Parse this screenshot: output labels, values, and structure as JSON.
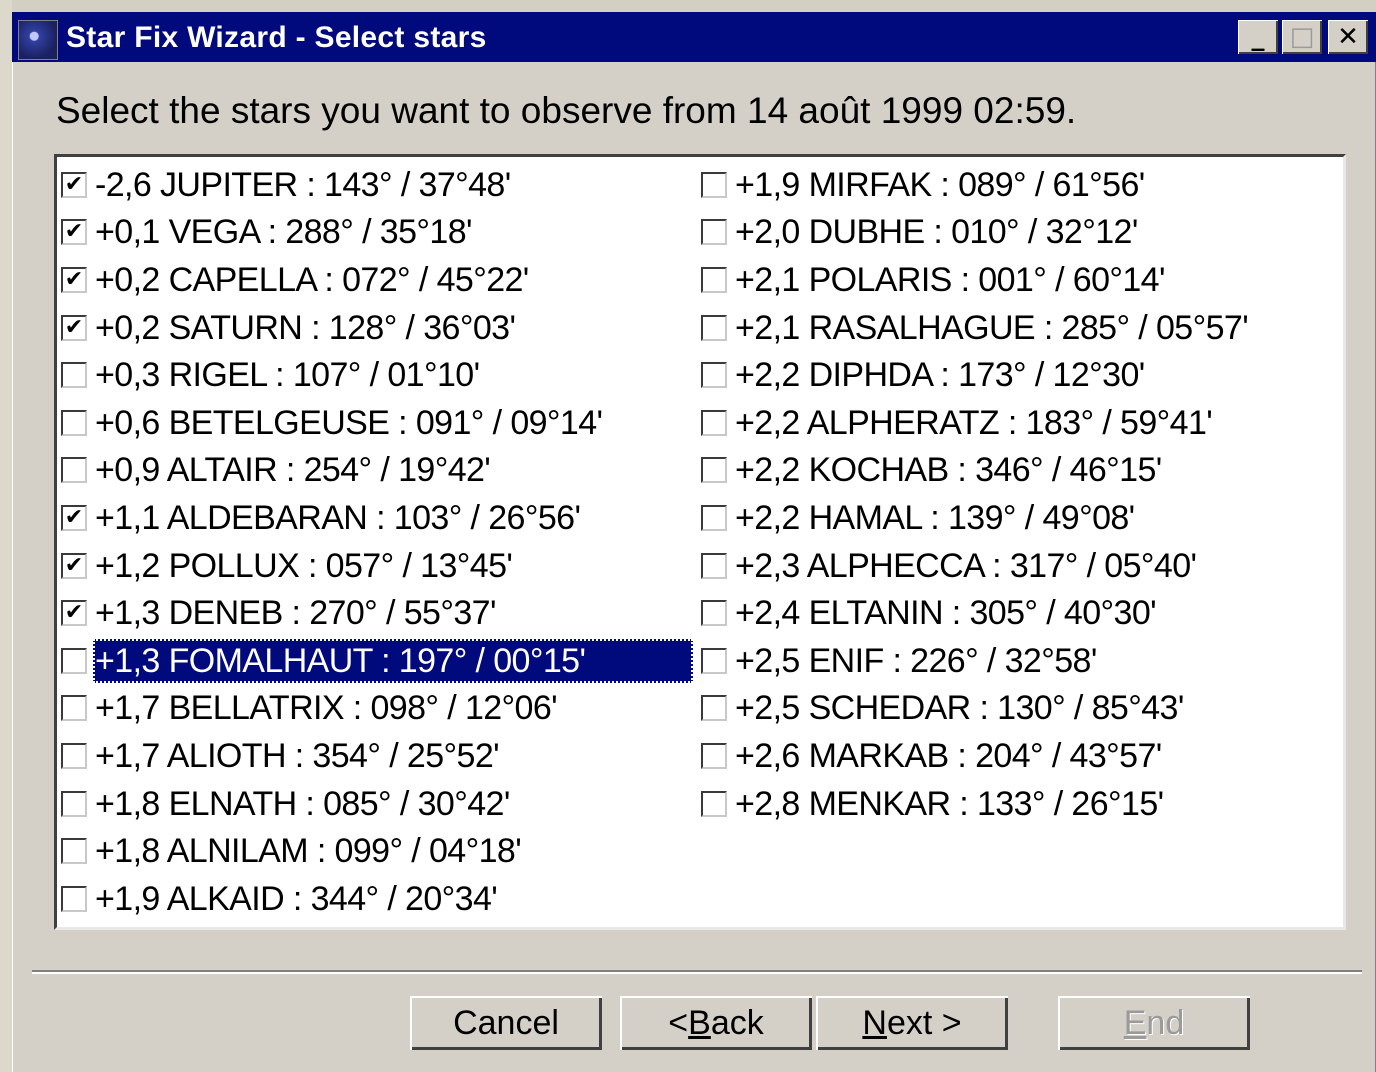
{
  "window": {
    "title": "Star Fix Wizard - Select stars",
    "minimize": "_",
    "maximize": "□",
    "close": "✕"
  },
  "instruction": "Select the stars you want to observe from 14 août 1999 02:59.",
  "stars_left": [
    {
      "label": "-2,6 JUPITER : 143° / 37°48'",
      "checked": true
    },
    {
      "label": "+0,1 VEGA : 288° / 35°18'",
      "checked": true
    },
    {
      "label": "+0,2 CAPELLA : 072° / 45°22'",
      "checked": true
    },
    {
      "label": "+0,2 SATURN : 128° / 36°03'",
      "checked": true
    },
    {
      "label": "+0,3 RIGEL : 107° / 01°10'",
      "checked": false
    },
    {
      "label": "+0,6 BETELGEUSE : 091° / 09°14'",
      "checked": false
    },
    {
      "label": "+0,9 ALTAIR : 254° / 19°42'",
      "checked": false
    },
    {
      "label": "+1,1 ALDEBARAN : 103° / 26°56'",
      "checked": true
    },
    {
      "label": "+1,2 POLLUX : 057° / 13°45'",
      "checked": true
    },
    {
      "label": "+1,3 DENEB : 270° / 55°37'",
      "checked": true
    },
    {
      "label": "+1,3 FOMALHAUT : 197° / 00°15'",
      "checked": false,
      "selected": true
    },
    {
      "label": "+1,7 BELLATRIX : 098° / 12°06'",
      "checked": false
    },
    {
      "label": "+1,7 ALIOTH : 354° / 25°52'",
      "checked": false
    },
    {
      "label": "+1,8 ELNATH : 085° / 30°42'",
      "checked": false
    },
    {
      "label": "+1,8 ALNILAM : 099° / 04°18'",
      "checked": false
    },
    {
      "label": "+1,9 ALKAID : 344° / 20°34'",
      "checked": false
    }
  ],
  "stars_right": [
    {
      "label": "+1,9 MIRFAK : 089° / 61°56'",
      "checked": false
    },
    {
      "label": "+2,0 DUBHE : 010° / 32°12'",
      "checked": false
    },
    {
      "label": "+2,1 POLARIS : 001° / 60°14'",
      "checked": false
    },
    {
      "label": "+2,1 RASALHAGUE : 285° / 05°57'",
      "checked": false
    },
    {
      "label": "+2,2 DIPHDA : 173° / 12°30'",
      "checked": false
    },
    {
      "label": "+2,2 ALPHERATZ : 183° / 59°41'",
      "checked": false
    },
    {
      "label": "+2,2 KOCHAB : 346° / 46°15'",
      "checked": false
    },
    {
      "label": "+2,2 HAMAL : 139° / 49°08'",
      "checked": false
    },
    {
      "label": "+2,3 ALPHECCA : 317° / 05°40'",
      "checked": false
    },
    {
      "label": "+2,4 ELTANIN : 305° / 40°30'",
      "checked": false
    },
    {
      "label": "+2,5 ENIF : 226° / 32°58'",
      "checked": false
    },
    {
      "label": "+2,5 SCHEDAR : 130° / 85°43'",
      "checked": false
    },
    {
      "label": "+2,6 MARKAB : 204° / 43°57'",
      "checked": false
    },
    {
      "label": "+2,8 MENKAR : 133° / 26°15'",
      "checked": false
    }
  ],
  "buttons": {
    "cancel": "Cancel",
    "back_prefix": "< ",
    "back_underlined": "B",
    "back_rest": "ack",
    "next_underlined": "N",
    "next_rest": "ext >",
    "end_underlined": "E",
    "end_rest": "nd",
    "end_disabled": true
  },
  "colors": {
    "titlebar": "#000a7c",
    "selection": "#000a7c",
    "face": "#d4d0c8"
  }
}
